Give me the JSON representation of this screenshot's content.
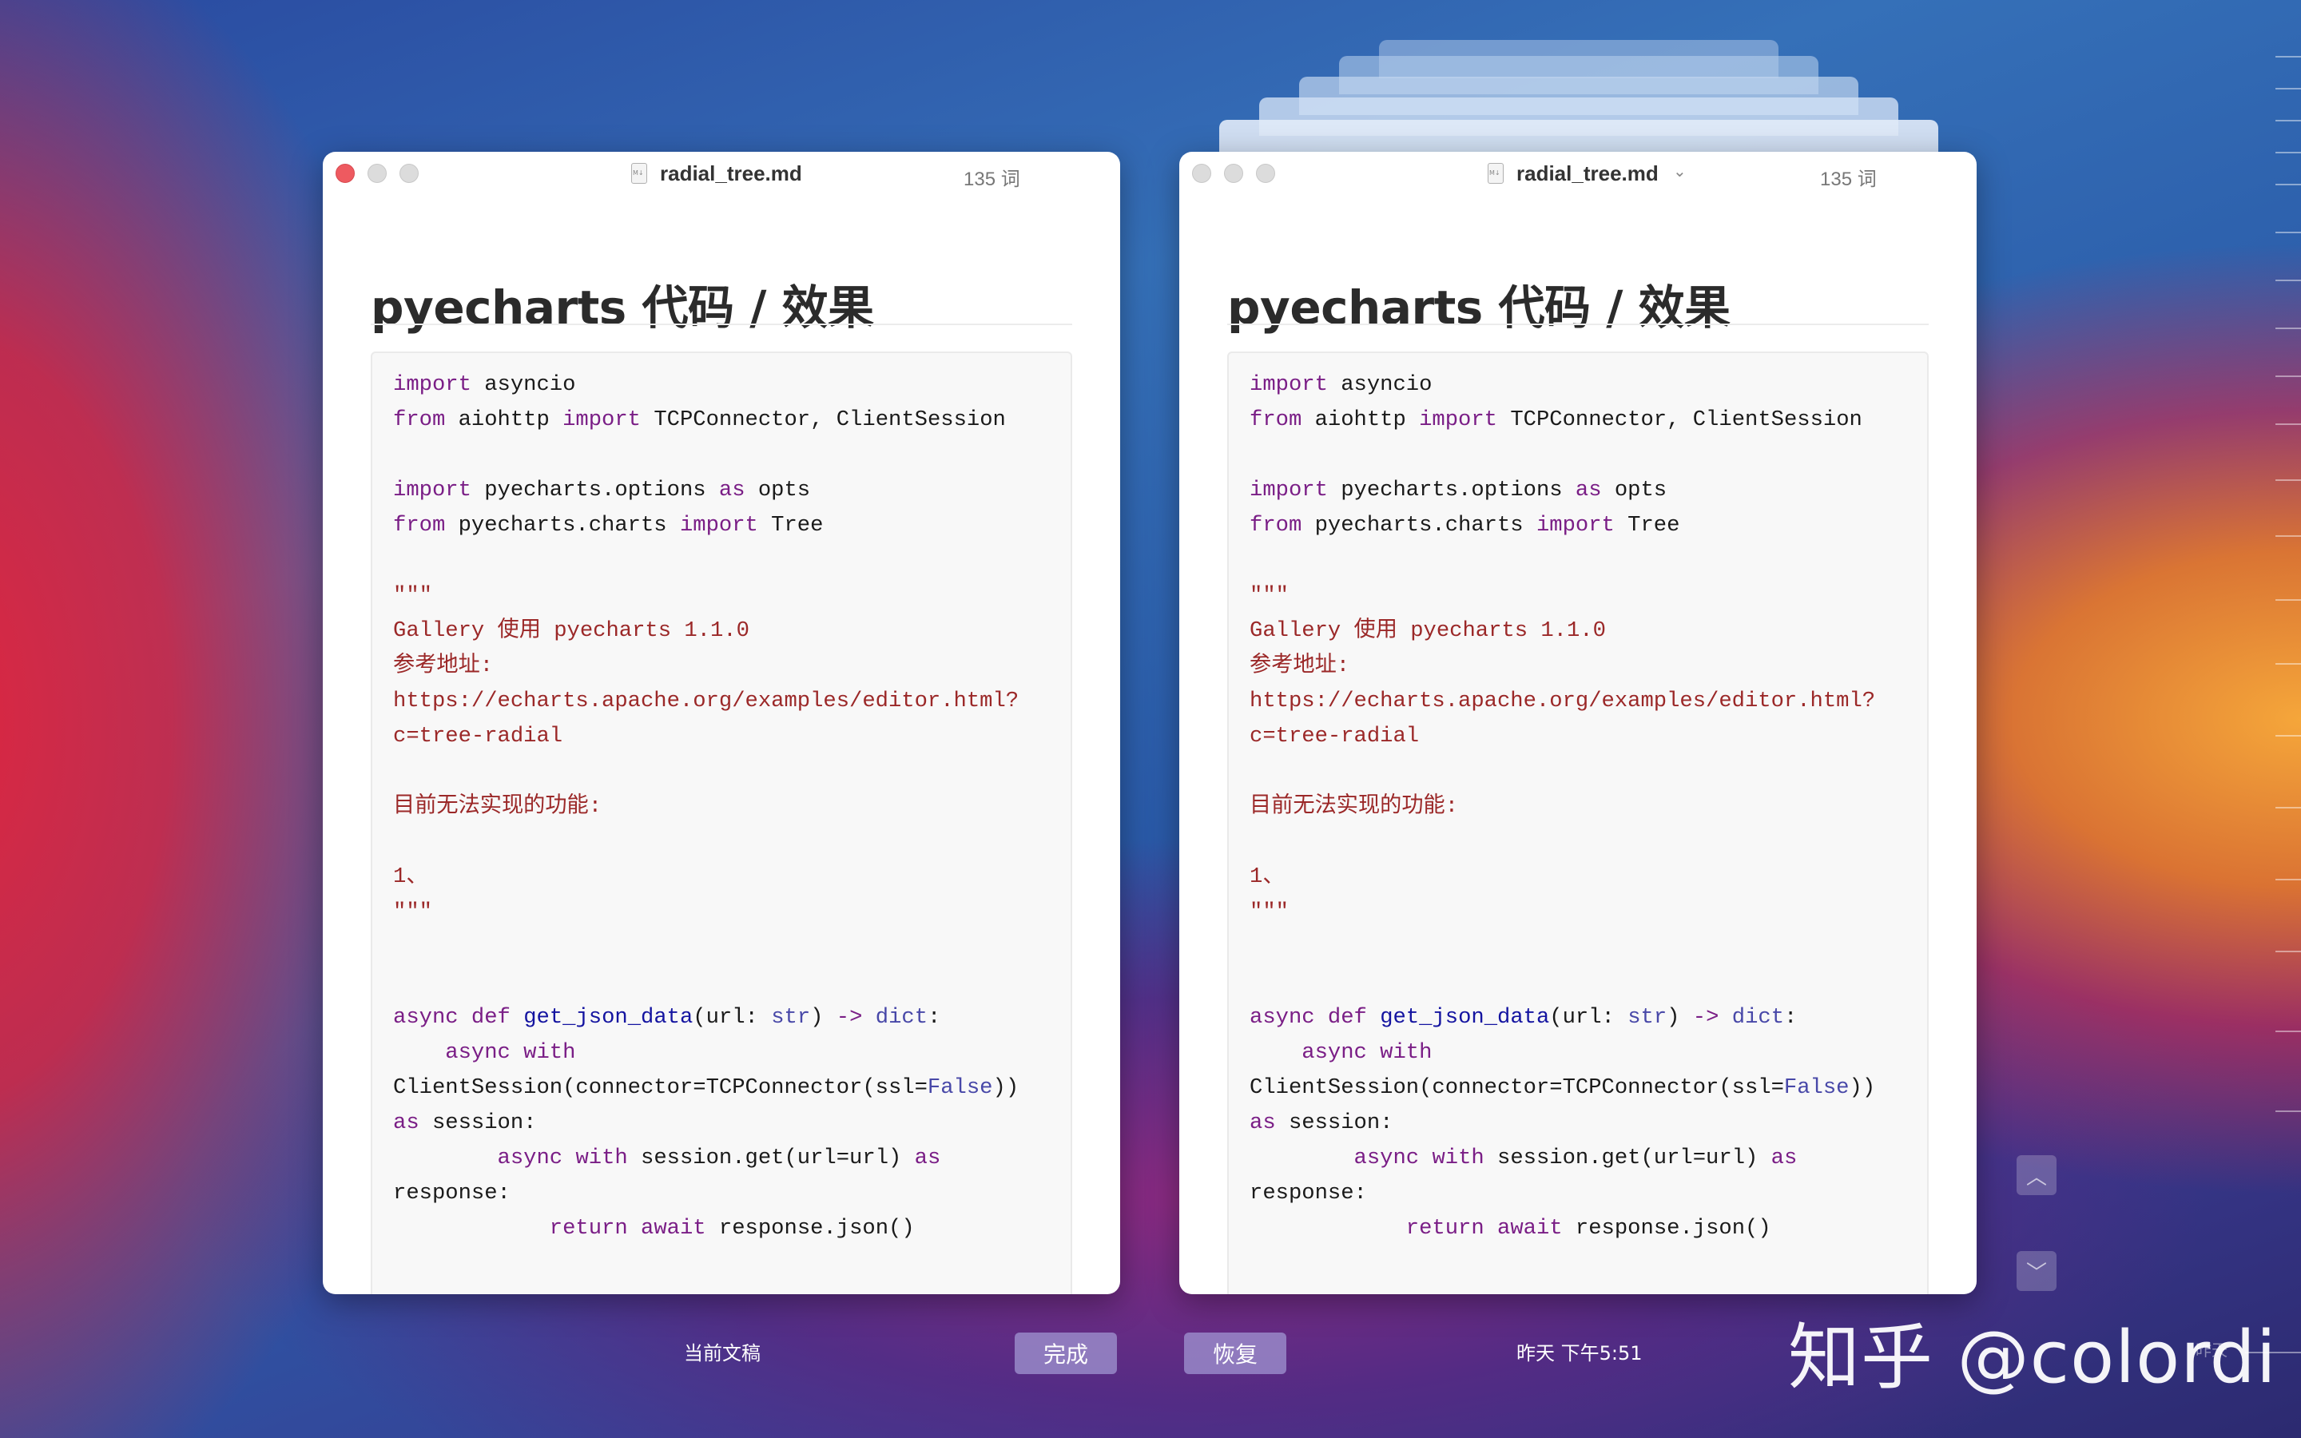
{
  "current": {
    "filename": "radial_tree.md",
    "word_count": "135 词",
    "heading": "pyecharts 代码 / 效果",
    "label": "当前文稿",
    "done_button": "完成"
  },
  "version": {
    "filename": "radial_tree.md",
    "word_count": "135 词",
    "heading": "pyecharts 代码 / 效果",
    "timestamp": "昨天 下午5:51",
    "restore_button": "恢复"
  },
  "code_lines": [
    "import asyncio",
    "from aiohttp import TCPConnector, ClientSession",
    "",
    "import pyecharts.options as opts",
    "from pyecharts.charts import Tree",
    "",
    "\"\"\"",
    "Gallery 使用 pyecharts 1.1.0",
    "参考地址:",
    "https://echarts.apache.org/examples/editor.html?",
    "c=tree-radial",
    "",
    "目前无法实现的功能:",
    "",
    "1、",
    "\"\"\"",
    "",
    "",
    "async def get_json_data(url: str) -> dict:",
    "    async with",
    "ClientSession(connector=TCPConnector(ssl=False))",
    "as session:",
    "        async with session.get(url=url) as",
    "response:",
    "            return await response.json()"
  ],
  "watermark": "知乎 @colordi",
  "edge_label": "昨天",
  "side_nav": {
    "up_icon": "chevron-up-icon",
    "down_icon": "chevron-down-icon"
  }
}
